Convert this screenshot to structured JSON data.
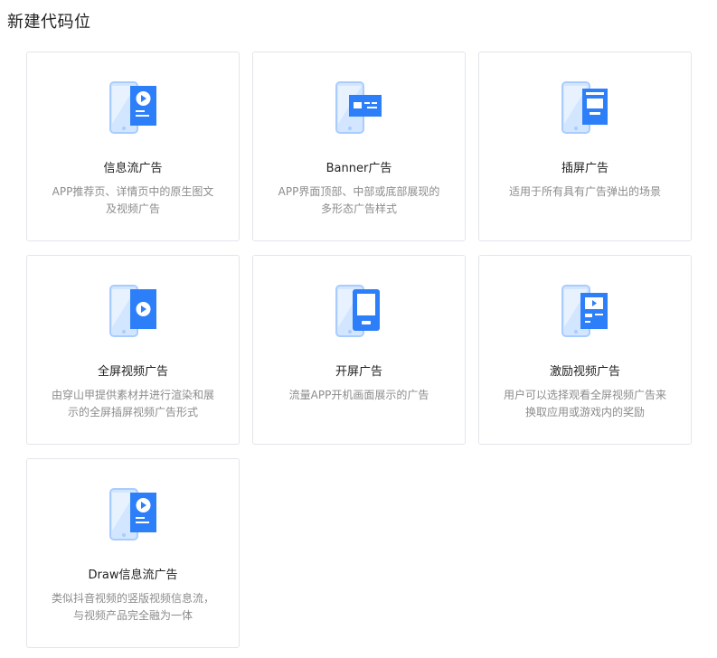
{
  "page_title": "新建代码位",
  "colors": {
    "accent": "#2d7ff9",
    "phone_light": "#d3e6ff",
    "phone_border": "#a9ccff"
  },
  "cards": [
    {
      "title": "信息流广告",
      "desc": "APP推荐页、详情页中的原生图文及视频广告",
      "icon": "feed-ad-icon"
    },
    {
      "title": "Banner广告",
      "desc": "APP界面顶部、中部或底部展现的多形态广告样式",
      "icon": "banner-ad-icon"
    },
    {
      "title": "插屏广告",
      "desc": "适用于所有具有广告弹出的场景",
      "icon": "interstitial-ad-icon"
    },
    {
      "title": "全屏视频广告",
      "desc": "由穿山甲提供素材并进行渲染和展示的全屏插屏视频广告形式",
      "icon": "fullscreen-video-ad-icon"
    },
    {
      "title": "开屏广告",
      "desc": "流量APP开机画面展示的广告",
      "icon": "splash-ad-icon"
    },
    {
      "title": "激励视频广告",
      "desc": "用户可以选择观看全屏视频广告来换取应用或游戏内的奖励",
      "icon": "rewarded-video-ad-icon"
    },
    {
      "title": "Draw信息流广告",
      "desc": "类似抖音视频的竖版视频信息流，与视频产品完全融为一体",
      "icon": "draw-feed-ad-icon"
    }
  ]
}
